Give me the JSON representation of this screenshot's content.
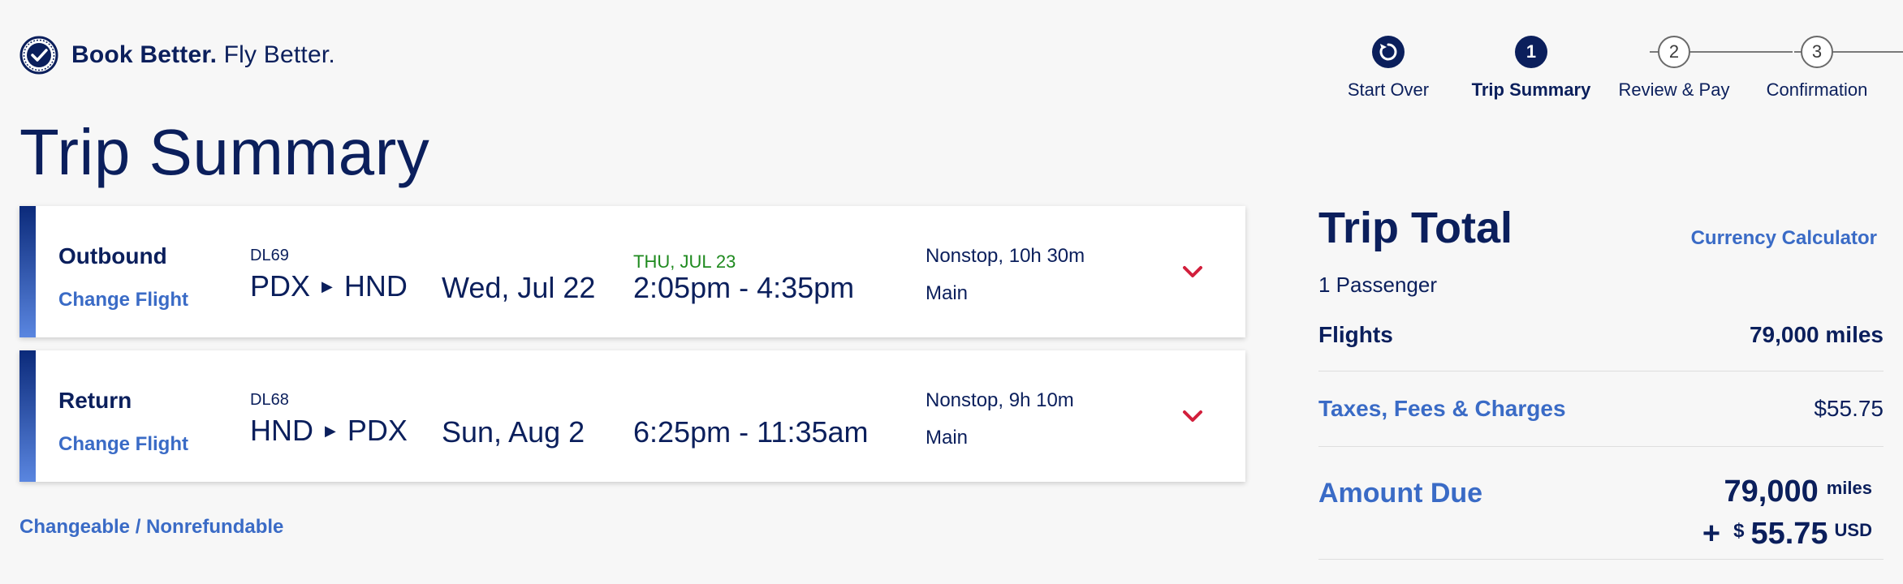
{
  "brand": {
    "bold": "Book Better.",
    "light": "Fly Better."
  },
  "stepper": {
    "start_over": "Start Over",
    "steps": [
      {
        "num": "1",
        "label": "Trip Summary"
      },
      {
        "num": "2",
        "label": "Review & Pay"
      },
      {
        "num": "3",
        "label": "Confirmation"
      }
    ],
    "active_index": 0
  },
  "page_title": "Trip Summary",
  "flights": [
    {
      "direction": "Outbound",
      "change": "Change Flight",
      "flight_no": "DL69",
      "from": "PDX",
      "to": "HND",
      "date": "Wed, Jul 22",
      "arrival_note": "THU, JUL 23",
      "times": "2:05pm - 4:35pm",
      "stops": "Nonstop, 10h 30m",
      "cabin": "Main"
    },
    {
      "direction": "Return",
      "change": "Change Flight",
      "flight_no": "DL68",
      "from": "HND",
      "to": "PDX",
      "date": "Sun, Aug 2",
      "arrival_note": "",
      "times": "6:25pm - 11:35am",
      "stops": "Nonstop, 9h 10m",
      "cabin": "Main"
    }
  ],
  "policy_text": "Changeable / Nonrefundable",
  "summary": {
    "title": "Trip Total",
    "currency_link": "Currency Calculator",
    "passengers": "1 Passenger",
    "flights_label": "Flights",
    "flights_value": "79,000 miles",
    "taxes_label": "Taxes, Fees & Charges",
    "taxes_value": "$55.75",
    "amount_label": "Amount Due",
    "amount_miles": "79,000",
    "amount_miles_unit": "miles",
    "amount_plus": "+",
    "amount_dollar_sign": "$",
    "amount_usd": "55.75",
    "amount_usd_unit": "USD"
  },
  "colors": {
    "navy": "#0b1f5c",
    "link": "#3a6bc6",
    "green": "#1f8a1f",
    "red": "#d21f3c"
  }
}
